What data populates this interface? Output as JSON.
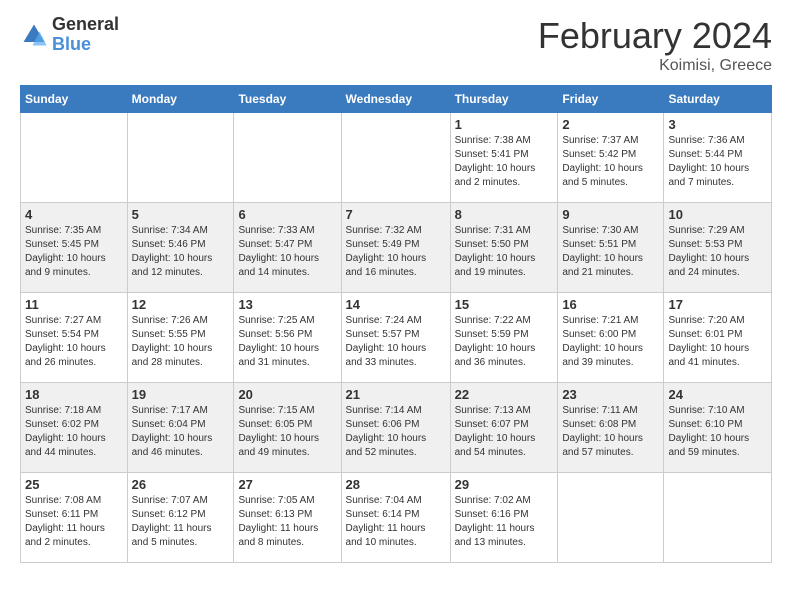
{
  "logo": {
    "general": "General",
    "blue": "Blue"
  },
  "title": "February 2024",
  "location": "Koimisi, Greece",
  "headers": [
    "Sunday",
    "Monday",
    "Tuesday",
    "Wednesday",
    "Thursday",
    "Friday",
    "Saturday"
  ],
  "weeks": [
    [
      {
        "day": "",
        "info": ""
      },
      {
        "day": "",
        "info": ""
      },
      {
        "day": "",
        "info": ""
      },
      {
        "day": "",
        "info": ""
      },
      {
        "day": "1",
        "info": "Sunrise: 7:38 AM\nSunset: 5:41 PM\nDaylight: 10 hours\nand 2 minutes."
      },
      {
        "day": "2",
        "info": "Sunrise: 7:37 AM\nSunset: 5:42 PM\nDaylight: 10 hours\nand 5 minutes."
      },
      {
        "day": "3",
        "info": "Sunrise: 7:36 AM\nSunset: 5:44 PM\nDaylight: 10 hours\nand 7 minutes."
      }
    ],
    [
      {
        "day": "4",
        "info": "Sunrise: 7:35 AM\nSunset: 5:45 PM\nDaylight: 10 hours\nand 9 minutes."
      },
      {
        "day": "5",
        "info": "Sunrise: 7:34 AM\nSunset: 5:46 PM\nDaylight: 10 hours\nand 12 minutes."
      },
      {
        "day": "6",
        "info": "Sunrise: 7:33 AM\nSunset: 5:47 PM\nDaylight: 10 hours\nand 14 minutes."
      },
      {
        "day": "7",
        "info": "Sunrise: 7:32 AM\nSunset: 5:49 PM\nDaylight: 10 hours\nand 16 minutes."
      },
      {
        "day": "8",
        "info": "Sunrise: 7:31 AM\nSunset: 5:50 PM\nDaylight: 10 hours\nand 19 minutes."
      },
      {
        "day": "9",
        "info": "Sunrise: 7:30 AM\nSunset: 5:51 PM\nDaylight: 10 hours\nand 21 minutes."
      },
      {
        "day": "10",
        "info": "Sunrise: 7:29 AM\nSunset: 5:53 PM\nDaylight: 10 hours\nand 24 minutes."
      }
    ],
    [
      {
        "day": "11",
        "info": "Sunrise: 7:27 AM\nSunset: 5:54 PM\nDaylight: 10 hours\nand 26 minutes."
      },
      {
        "day": "12",
        "info": "Sunrise: 7:26 AM\nSunset: 5:55 PM\nDaylight: 10 hours\nand 28 minutes."
      },
      {
        "day": "13",
        "info": "Sunrise: 7:25 AM\nSunset: 5:56 PM\nDaylight: 10 hours\nand 31 minutes."
      },
      {
        "day": "14",
        "info": "Sunrise: 7:24 AM\nSunset: 5:57 PM\nDaylight: 10 hours\nand 33 minutes."
      },
      {
        "day": "15",
        "info": "Sunrise: 7:22 AM\nSunset: 5:59 PM\nDaylight: 10 hours\nand 36 minutes."
      },
      {
        "day": "16",
        "info": "Sunrise: 7:21 AM\nSunset: 6:00 PM\nDaylight: 10 hours\nand 39 minutes."
      },
      {
        "day": "17",
        "info": "Sunrise: 7:20 AM\nSunset: 6:01 PM\nDaylight: 10 hours\nand 41 minutes."
      }
    ],
    [
      {
        "day": "18",
        "info": "Sunrise: 7:18 AM\nSunset: 6:02 PM\nDaylight: 10 hours\nand 44 minutes."
      },
      {
        "day": "19",
        "info": "Sunrise: 7:17 AM\nSunset: 6:04 PM\nDaylight: 10 hours\nand 46 minutes."
      },
      {
        "day": "20",
        "info": "Sunrise: 7:15 AM\nSunset: 6:05 PM\nDaylight: 10 hours\nand 49 minutes."
      },
      {
        "day": "21",
        "info": "Sunrise: 7:14 AM\nSunset: 6:06 PM\nDaylight: 10 hours\nand 52 minutes."
      },
      {
        "day": "22",
        "info": "Sunrise: 7:13 AM\nSunset: 6:07 PM\nDaylight: 10 hours\nand 54 minutes."
      },
      {
        "day": "23",
        "info": "Sunrise: 7:11 AM\nSunset: 6:08 PM\nDaylight: 10 hours\nand 57 minutes."
      },
      {
        "day": "24",
        "info": "Sunrise: 7:10 AM\nSunset: 6:10 PM\nDaylight: 10 hours\nand 59 minutes."
      }
    ],
    [
      {
        "day": "25",
        "info": "Sunrise: 7:08 AM\nSunset: 6:11 PM\nDaylight: 11 hours\nand 2 minutes."
      },
      {
        "day": "26",
        "info": "Sunrise: 7:07 AM\nSunset: 6:12 PM\nDaylight: 11 hours\nand 5 minutes."
      },
      {
        "day": "27",
        "info": "Sunrise: 7:05 AM\nSunset: 6:13 PM\nDaylight: 11 hours\nand 8 minutes."
      },
      {
        "day": "28",
        "info": "Sunrise: 7:04 AM\nSunset: 6:14 PM\nDaylight: 11 hours\nand 10 minutes."
      },
      {
        "day": "29",
        "info": "Sunrise: 7:02 AM\nSunset: 6:16 PM\nDaylight: 11 hours\nand 13 minutes."
      },
      {
        "day": "",
        "info": ""
      },
      {
        "day": "",
        "info": ""
      }
    ]
  ]
}
